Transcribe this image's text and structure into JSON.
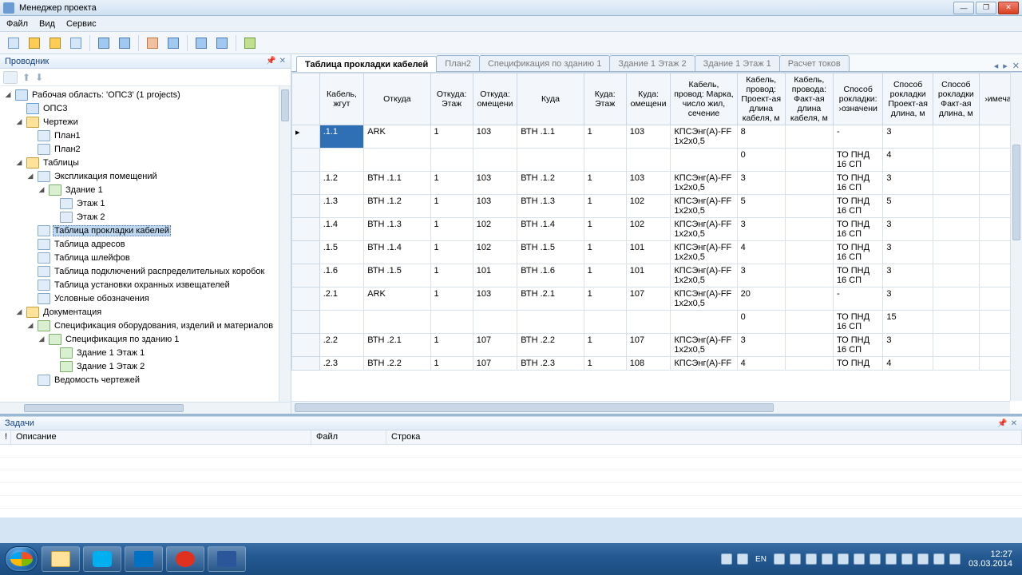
{
  "window": {
    "title": "Менеджер проекта"
  },
  "menu": {
    "file": "Файл",
    "view": "Вид",
    "service": "Сервис"
  },
  "explorer": {
    "title": "Проводник",
    "root": "Рабочая область: 'ОПС3' (1 projects)",
    "project": "ОПС3",
    "drawings": "Чертежи",
    "plan1": "План1",
    "plan2": "План2",
    "tables": "Таблицы",
    "explication": "Экспликация помещений",
    "building1": "Здание 1",
    "floor1": "Этаж 1",
    "floor2": "Этаж 2",
    "cable_table": "Таблица прокладки кабелей",
    "addr_table": "Таблица адресов",
    "loops_table": "Таблица шлейфов",
    "junction_table": "Таблица подключений распределительных коробок",
    "detectors_table": "Таблица установки охранных извещателей",
    "legend": "Условные обозначения",
    "documentation": "Документация",
    "spec_main": "Спецификация оборудования, изделий и материалов",
    "spec_building": "Спецификация по зданию 1",
    "spec_b1f1": "Здание 1 Этаж 1",
    "spec_b1f2": "Здание 1 Этаж 2",
    "drawings_list": "Ведомость чертежей"
  },
  "tabs": {
    "t0": "Таблица прокладки кабелей",
    "t1": "План2",
    "t2": "Спецификация по зданию 1",
    "t3": "Здание 1 Этаж 2",
    "t4": "Здание 1 Этаж 1",
    "t5": "Расчет токов"
  },
  "columns": {
    "c0": "Кабель, жгут",
    "c1": "Откуда",
    "c2": "Откуда: Этаж",
    "c3": "Откуда: омещени",
    "c4": "Куда",
    "c5": "Куда: Этаж",
    "c6": "Куда: омещени",
    "c7": "Кабель, провод: Марка, число жил, сечение",
    "c8": "Кабель, провод: Проект-ая длина кабеля, м",
    "c9": "Кабель, провода: Факт-ая длина кабеля, м",
    "c10": "Способ рокладки: ›означени",
    "c11": "Способ рокладки Проект-ая длина, м",
    "c12": "Способ рокладки Факт-ая длина, м",
    "c13": "›имечан"
  },
  "rows": [
    {
      "c0": ".1.1",
      "c1": "ARK",
      "c2": "1",
      "c3": "103",
      "c4": "ВТН .1.1",
      "c5": "1",
      "c6": "103",
      "c7": "КПСЭнг(А)-FF 1x2x0,5",
      "c8": "8",
      "c9": "",
      "c10": "-",
      "c11": "3",
      "c12": ""
    },
    {
      "c0": "",
      "c1": "",
      "c2": "",
      "c3": "",
      "c4": "",
      "c5": "",
      "c6": "",
      "c7": "",
      "c8": "0",
      "c9": "",
      "c10": "ТО ПНД 16 СП",
      "c11": "4",
      "c12": ""
    },
    {
      "c0": ".1.2",
      "c1": "ВТН .1.1",
      "c2": "1",
      "c3": "103",
      "c4": "ВТН .1.2",
      "c5": "1",
      "c6": "103",
      "c7": "КПСЭнг(А)-FF 1x2x0,5",
      "c8": "3",
      "c9": "",
      "c10": "ТО ПНД 16 СП",
      "c11": "3",
      "c12": ""
    },
    {
      "c0": ".1.3",
      "c1": "ВТН .1.2",
      "c2": "1",
      "c3": "103",
      "c4": "ВТН .1.3",
      "c5": "1",
      "c6": "102",
      "c7": "КПСЭнг(А)-FF 1x2x0,5",
      "c8": "5",
      "c9": "",
      "c10": "ТО ПНД 16 СП",
      "c11": "5",
      "c12": ""
    },
    {
      "c0": ".1.4",
      "c1": "ВТН .1.3",
      "c2": "1",
      "c3": "102",
      "c4": "ВТН .1.4",
      "c5": "1",
      "c6": "102",
      "c7": "КПСЭнг(А)-FF 1x2x0,5",
      "c8": "3",
      "c9": "",
      "c10": "ТО ПНД 16 СП",
      "c11": "3",
      "c12": ""
    },
    {
      "c0": ".1.5",
      "c1": "ВТН .1.4",
      "c2": "1",
      "c3": "102",
      "c4": "ВТН .1.5",
      "c5": "1",
      "c6": "101",
      "c7": "КПСЭнг(А)-FF 1x2x0,5",
      "c8": "4",
      "c9": "",
      "c10": "ТО ПНД 16 СП",
      "c11": "3",
      "c12": ""
    },
    {
      "c0": ".1.6",
      "c1": "ВТН .1.5",
      "c2": "1",
      "c3": "101",
      "c4": "ВТН .1.6",
      "c5": "1",
      "c6": "101",
      "c7": "КПСЭнг(А)-FF 1x2x0,5",
      "c8": "3",
      "c9": "",
      "c10": "ТО ПНД 16 СП",
      "c11": "3",
      "c12": ""
    },
    {
      "c0": ".2.1",
      "c1": "ARK",
      "c2": "1",
      "c3": "103",
      "c4": "ВТН .2.1",
      "c5": "1",
      "c6": "107",
      "c7": "КПСЭнг(А)-FF 1x2x0,5",
      "c8": "20",
      "c9": "",
      "c10": "-",
      "c11": "3",
      "c12": ""
    },
    {
      "c0": "",
      "c1": "",
      "c2": "",
      "c3": "",
      "c4": "",
      "c5": "",
      "c6": "",
      "c7": "",
      "c8": "0",
      "c9": "",
      "c10": "ТО ПНД 16 СП",
      "c11": "15",
      "c12": ""
    },
    {
      "c0": ".2.2",
      "c1": "ВТН .2.1",
      "c2": "1",
      "c3": "107",
      "c4": "ВТН .2.2",
      "c5": "1",
      "c6": "107",
      "c7": "КПСЭнг(А)-FF 1x2x0,5",
      "c8": "3",
      "c9": "",
      "c10": "ТО ПНД 16 СП",
      "c11": "3",
      "c12": ""
    },
    {
      "c0": ".2.3",
      "c1": "ВТН .2.2",
      "c2": "1",
      "c3": "107",
      "c4": "ВТН .2.3",
      "c5": "1",
      "c6": "108",
      "c7": "КПСЭнг(А)-FF",
      "c8": "4",
      "c9": "",
      "c10": "ТО ПНД",
      "c11": "4",
      "c12": ""
    }
  ],
  "tasks": {
    "title": "Задачи",
    "col_bang": "!",
    "col_desc": "Описание",
    "col_file": "Файл",
    "col_line": "Строка"
  },
  "tray": {
    "lang": "EN"
  },
  "clock": {
    "time": "12:27",
    "date": "03.03.2014"
  }
}
